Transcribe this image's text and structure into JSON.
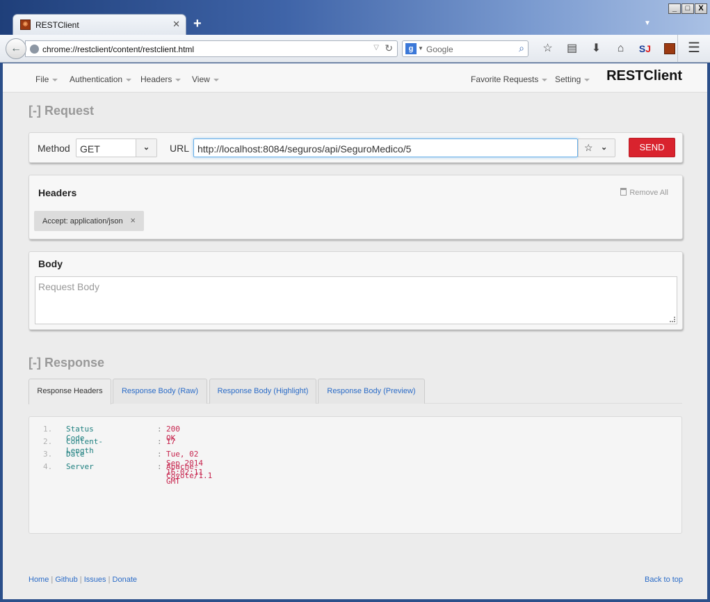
{
  "window": {
    "tab_title": "RESTClient",
    "newtab": "+",
    "min": "_",
    "max": "□",
    "close": "X"
  },
  "browser": {
    "url": "chrome://restclient/content/restclient.html",
    "search_placeholder": "Google"
  },
  "app": {
    "brand": "RESTClient",
    "menu_left": [
      "File",
      "Authentication",
      "Headers",
      "View"
    ],
    "menu_right": [
      "Favorite Requests",
      "Setting"
    ]
  },
  "request": {
    "section_title": "[-] Request",
    "method_label": "Method",
    "method_value": "GET",
    "url_label": "URL",
    "url_value": "http://localhost:8084/seguros/api/SeguroMedico/5",
    "send_label": "SEND"
  },
  "headers": {
    "title": "Headers",
    "remove_all": "Remove All",
    "items": [
      "Accept: application/json"
    ]
  },
  "body": {
    "title": "Body",
    "placeholder": "Request Body"
  },
  "response": {
    "section_title": "[-] Response",
    "tabs": [
      "Response Headers",
      "Response Body (Raw)",
      "Response Body (Highlight)",
      "Response Body (Preview)"
    ],
    "active_tab": 0,
    "lines": [
      {
        "num": "1.",
        "key": "Status Code",
        "value": "200 OK"
      },
      {
        "num": "2.",
        "key": "Content-Length",
        "value": "17"
      },
      {
        "num": "3.",
        "key": "Date",
        "value": "Tue, 02 Sep 2014 16:02:11 GMT"
      },
      {
        "num": "4.",
        "key": "Server",
        "value": "Apache-Coyote/1.1"
      }
    ]
  },
  "footer": {
    "links": [
      "Home",
      "Github",
      "Issues",
      "Donate"
    ],
    "back_to_top": "Back to top"
  }
}
